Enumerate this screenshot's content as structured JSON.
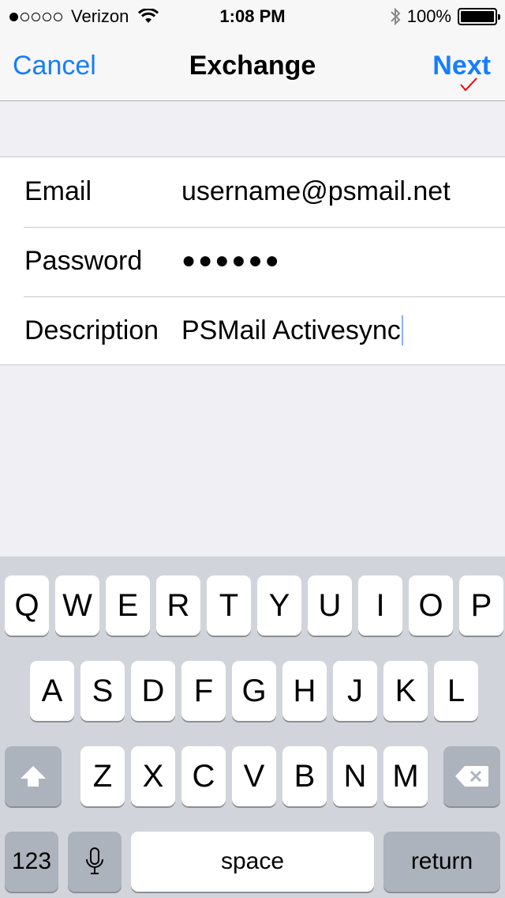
{
  "status_bar": {
    "carrier": "Verizon",
    "signal_bars_filled": 1,
    "signal_bars_total": 5,
    "time": "1:08 PM",
    "battery": "100%"
  },
  "nav": {
    "cancel_label": "Cancel",
    "title": "Exchange",
    "next_label": "Next",
    "accent_color": "#157efb"
  },
  "form": {
    "rows": [
      {
        "label": "Email",
        "value": "username@psmail.net"
      },
      {
        "label": "Password",
        "value": "●●●●●●"
      },
      {
        "label": "Description",
        "value": "PSMail Activesync"
      }
    ]
  },
  "keyboard": {
    "row1": [
      "Q",
      "W",
      "E",
      "R",
      "T",
      "Y",
      "U",
      "I",
      "O",
      "P"
    ],
    "row2": [
      "A",
      "S",
      "D",
      "F",
      "G",
      "H",
      "J",
      "K",
      "L"
    ],
    "row3": [
      "Z",
      "X",
      "C",
      "V",
      "B",
      "N",
      "M"
    ],
    "shift_icon": "shift-arrow-icon",
    "delete_icon": "backspace-icon",
    "numbers_label": "123",
    "mic_icon": "microphone-icon",
    "space_label": "space",
    "return_label": "return"
  }
}
